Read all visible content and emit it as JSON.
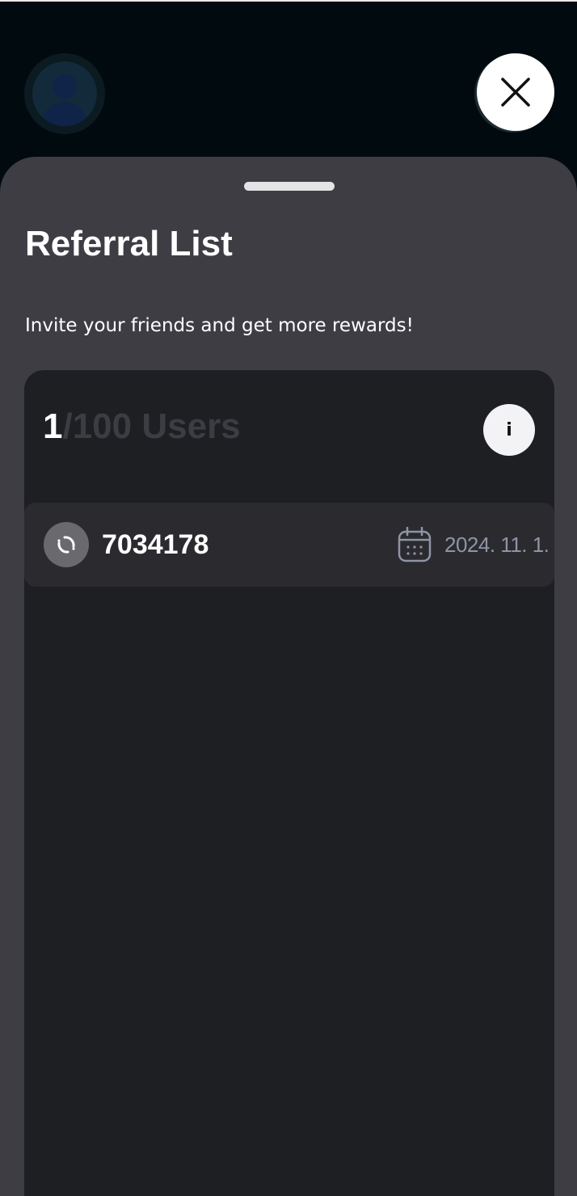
{
  "header": {
    "close_label": "Close",
    "avatar_alt": "user-avatar"
  },
  "sheet": {
    "title": "Referral List",
    "subtitle": "Invite your friends and get more rewards!",
    "count": {
      "current": "1",
      "total_suffix": "/100 Users"
    },
    "info_label": "i",
    "referrals": [
      {
        "code": "7034178",
        "date": "2024. 11. 1.",
        "icon": "link-icon"
      }
    ]
  },
  "colors": {
    "background": "#010a0e",
    "sheet": "#3e3d44",
    "card": "#1e1f23",
    "row": "#2b2b2f",
    "muted_count": "#3c3d42",
    "date_text": "#8e94a6"
  }
}
